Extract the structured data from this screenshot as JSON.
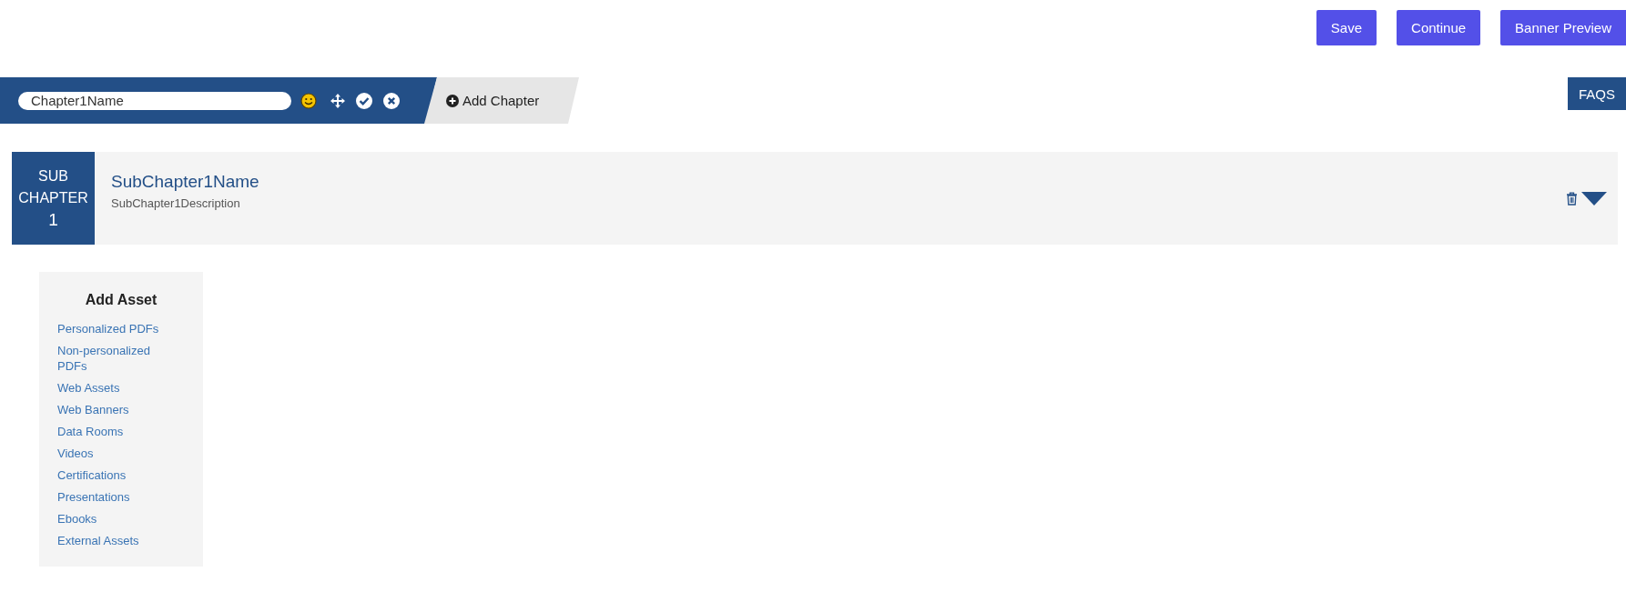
{
  "header_buttons": [
    {
      "label": "Save"
    },
    {
      "label": "Continue"
    },
    {
      "label": "Banner Preview"
    }
  ],
  "chapter": {
    "name_field": {
      "value": "Chapter1Name"
    },
    "add_chapter": "Add Chapter"
  },
  "faqs": "FAQS",
  "subchapter": {
    "badge_lines": [
      "SUB",
      "CHAPTER",
      "1"
    ],
    "name": "SubChapter1Name",
    "description": "SubChapter1Description"
  },
  "add_asset": {
    "title": "Add Asset",
    "links": [
      "Personalized PDFs",
      "Non-personalized PDFs",
      "Web Assets",
      "Web Banners",
      "Data Rooms",
      "Videos",
      "Certifications",
      "Presentations",
      "Ebooks",
      "External Assets"
    ]
  }
}
